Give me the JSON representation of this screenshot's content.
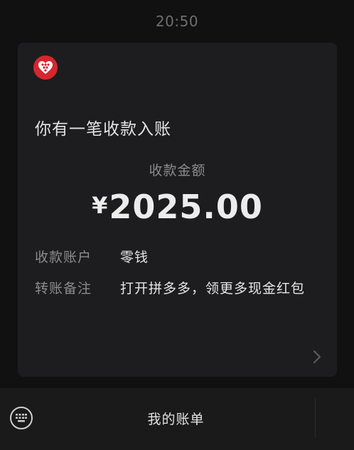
{
  "status_bar": {
    "time": "20:50"
  },
  "card": {
    "logo_icon": "pinduoduo-logo",
    "title": "你有一笔收款入账",
    "amount_label": "收款金额",
    "currency_symbol": "¥",
    "amount": "2025.00",
    "rows": [
      {
        "label": "收款账户",
        "value": "零钱"
      },
      {
        "label": "转账备注",
        "value": "打开拼多多，领更多现金红包"
      }
    ],
    "more_icon": "chevron-right-icon"
  },
  "bottom_bar": {
    "keyboard_icon": "keyboard-icon",
    "menu_label": "我的账单"
  },
  "colors": {
    "background": "#111111",
    "card": "#1d1d1f",
    "brand_red": "#d7262e",
    "secondary_text": "#8b8b8b"
  }
}
